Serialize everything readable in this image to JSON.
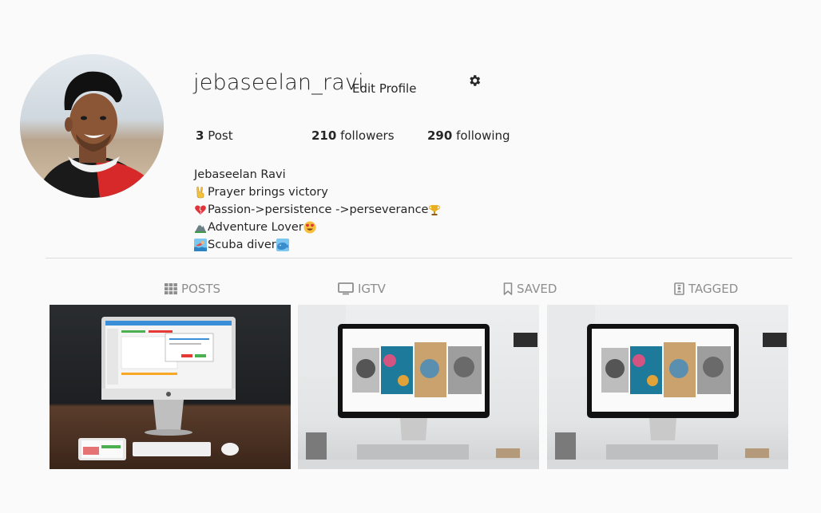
{
  "profile": {
    "username": "jebaseelan_ravi",
    "edit_profile_label": "Edit Profile",
    "settings_icon": "gear-icon"
  },
  "stats": {
    "posts_count": "3",
    "posts_label": "Post",
    "followers_count": "210",
    "followers_label": "followers",
    "following_count": "290",
    "following_label": "following"
  },
  "bio": {
    "name": "Jebaseelan Ravi",
    "lines": [
      {
        "text": "Prayer brings victory",
        "icon_before": "victory-hand-icon"
      },
      {
        "text": "Passion->persistence ->perseverance",
        "icon_before": "heart-icon",
        "icon_after": "trophy-icon"
      },
      {
        "text": "Adventure Lover",
        "icon_before": "mountain-icon",
        "icon_after": "heart-eyes-icon"
      },
      {
        "text": "Scuba diver",
        "icon_before": "swimmer-icon",
        "icon_after": "whale-icon"
      }
    ]
  },
  "tabs": [
    {
      "label": "POSTS",
      "icon": "grid-icon"
    },
    {
      "label": "IGTV",
      "icon": "tv-icon"
    },
    {
      "label": "SAVED",
      "icon": "bookmark-icon"
    },
    {
      "label": "TAGGED",
      "icon": "tag-portrait-icon"
    }
  ],
  "posts": [
    {
      "subject": "imac-dashboard"
    },
    {
      "subject": "imac-gallery"
    },
    {
      "subject": "imac-gallery"
    }
  ],
  "colors": {
    "background": "#fafafa",
    "text": "#262626",
    "muted": "#8e8e8e",
    "divider": "#dbdbdb"
  }
}
